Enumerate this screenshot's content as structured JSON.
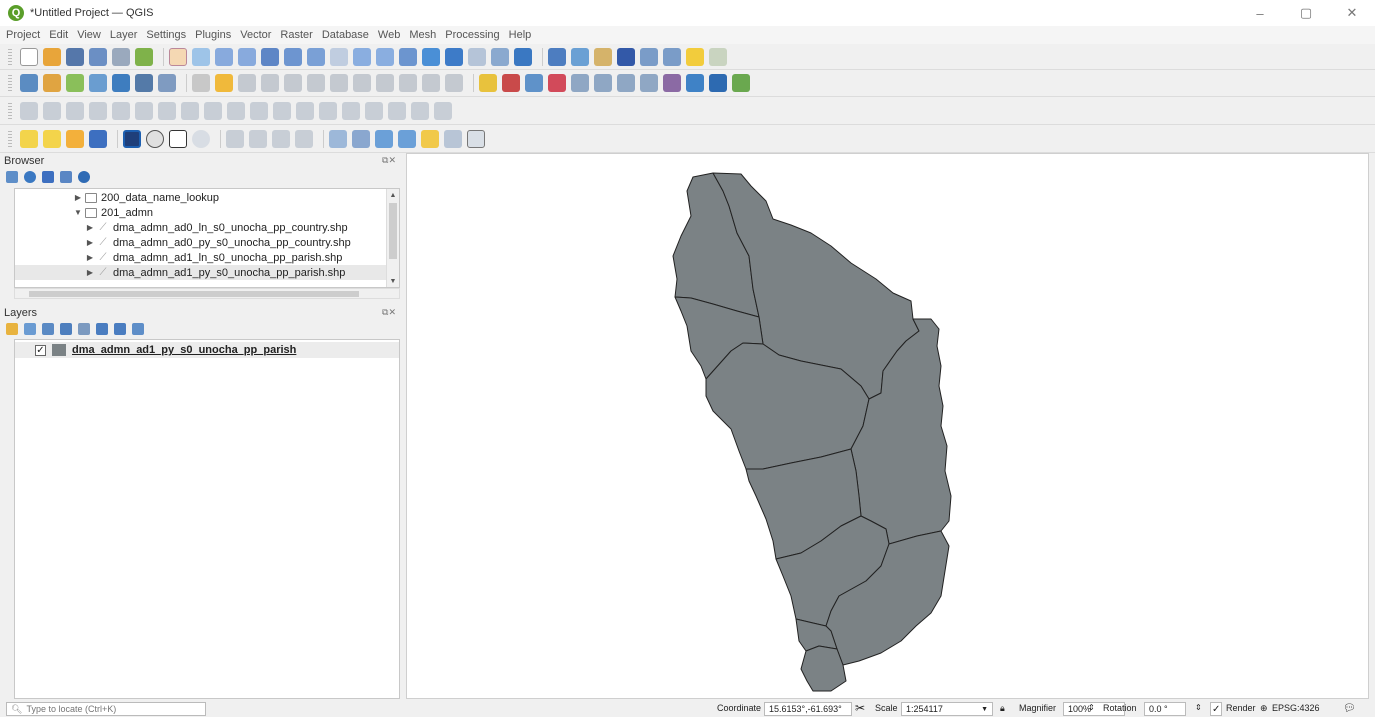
{
  "window": {
    "title": "*Untitled Project — QGIS",
    "app_icon": "Q",
    "controls": [
      "–",
      "▢",
      "✕"
    ]
  },
  "menu": [
    "Project",
    "Edit",
    "View",
    "Layer",
    "Settings",
    "Plugins",
    "Vector",
    "Raster",
    "Database",
    "Web",
    "Mesh",
    "Processing",
    "Help"
  ],
  "browser": {
    "title": "Browser",
    "items": [
      {
        "label": "200_data_name_lookup",
        "type": "folder",
        "expanded": false
      },
      {
        "label": "201_admn",
        "type": "folder",
        "expanded": true
      },
      {
        "label": "dma_admn_ad0_ln_s0_unocha_pp_country.shp",
        "type": "shapefile"
      },
      {
        "label": "dma_admn_ad0_py_s0_unocha_pp_country.shp",
        "type": "shapefile"
      },
      {
        "label": "dma_admn_ad1_ln_s0_unocha_pp_parish.shp",
        "type": "shapefile"
      },
      {
        "label": "dma_admn_ad1_py_s0_unocha_pp_parish.shp",
        "type": "shapefile",
        "selected": true
      }
    ]
  },
  "layers": {
    "title": "Layers",
    "items": [
      {
        "name": "dma_admn_ad1_py_s0_unocha_pp_parish",
        "checked": "✓",
        "color": "#7b8285"
      }
    ]
  },
  "map": {
    "fill_color": "#7b8285",
    "stroke_color": "#222222"
  },
  "status": {
    "locator_placeholder": "Type to locate (Ctrl+K)",
    "coordinate_label": "Coordinate",
    "coordinate_value": "15.6153°,-61.693°",
    "scale_label": "Scale",
    "scale_value": "1:254117",
    "magnifier_label": "Magnifier",
    "magnifier_value": "100%",
    "rotation_label": "Rotation",
    "rotation_value": "0.0 °",
    "render_label": "Render",
    "render_check": "✓",
    "crs": "EPSG:4326"
  }
}
